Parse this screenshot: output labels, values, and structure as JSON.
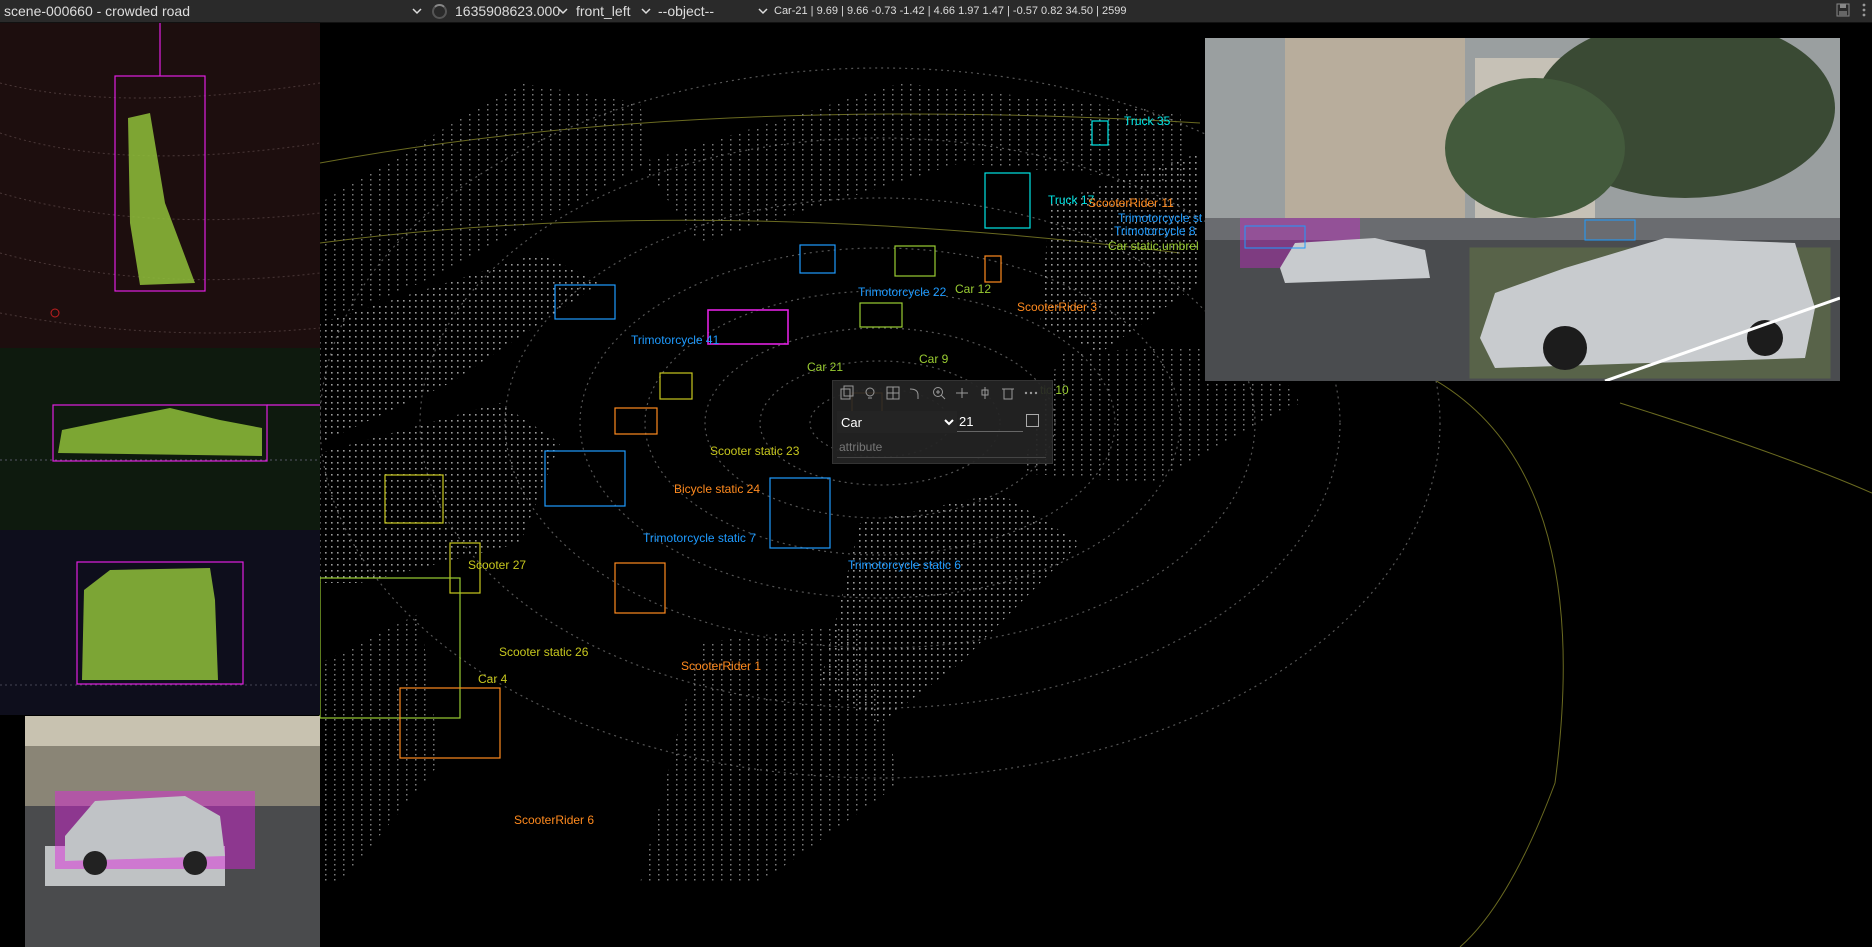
{
  "toolbar": {
    "scene": "scene-000660 - crowded road",
    "frame": "1635908623.000",
    "camera": "front_left",
    "object": "--object--",
    "box_info": "Car-21 | 9.69 | 9.66 -0.73 -1.42 | 4.66 1.97 1.47 | -0.57 0.82 34.50 | 2599"
  },
  "labels": [
    {
      "text": "Truck 35",
      "color": "#00e5e5"
    },
    {
      "text": "Truck 17",
      "color": "#00e5e5"
    },
    {
      "text": "ScooterRider 11",
      "color": "#ff8a1e"
    },
    {
      "text": "Trimotorcycle st",
      "color": "#1e9bff"
    },
    {
      "text": "Trimotorcycle 8",
      "color": "#1e9bff"
    },
    {
      "text": "Car static,umbrel",
      "color": "#9acd32"
    },
    {
      "text": "Trimotorcycle 22",
      "color": "#1e9bff"
    },
    {
      "text": "Car 12",
      "color": "#9acd32"
    },
    {
      "text": "ScooterRider 3",
      "color": "#ff8a1e"
    },
    {
      "text": "Trimotorcycle 41",
      "color": "#1e9bff"
    },
    {
      "text": "Car 21",
      "color": "#9acd32"
    },
    {
      "text": "Car 9",
      "color": "#9acd32"
    },
    {
      "text": "tic 10",
      "color": "#9acd32"
    },
    {
      "text": "Scooter static 23",
      "color": "#c8c81e"
    },
    {
      "text": "Bicycle static 24",
      "color": "#ff8a1e"
    },
    {
      "text": "Trimotorcycle static 7",
      "color": "#1e9bff"
    },
    {
      "text": "Trimotorcycle static 6",
      "color": "#1e9bff"
    },
    {
      "text": "Scooter 27",
      "color": "#c8c81e"
    },
    {
      "text": "Scooter static 26",
      "color": "#c8c81e"
    },
    {
      "text": "Car 4",
      "color": "#c8c81e"
    },
    {
      "text": "ScooterRider 1",
      "color": "#ff8a1e"
    },
    {
      "text": "ScooterRider 6",
      "color": "#ff8a1e"
    }
  ],
  "popup": {
    "class_options": [
      "Car"
    ],
    "class_value": "Car",
    "id_value": "21",
    "attribute_placeholder": "attribute",
    "icons": [
      "copy-icon",
      "light-icon",
      "layout-icon",
      "curve-icon",
      "zoom-icon",
      "fit-icon",
      "pin-icon",
      "delete-icon",
      "more-icon"
    ]
  },
  "colors": {
    "car": "#9acd32",
    "truck": "#00e5e5",
    "trimotorcycle": "#1e9bff",
    "scooter": "#c8c81e",
    "rider": "#ff8a1e",
    "selected": "#e020e0"
  }
}
